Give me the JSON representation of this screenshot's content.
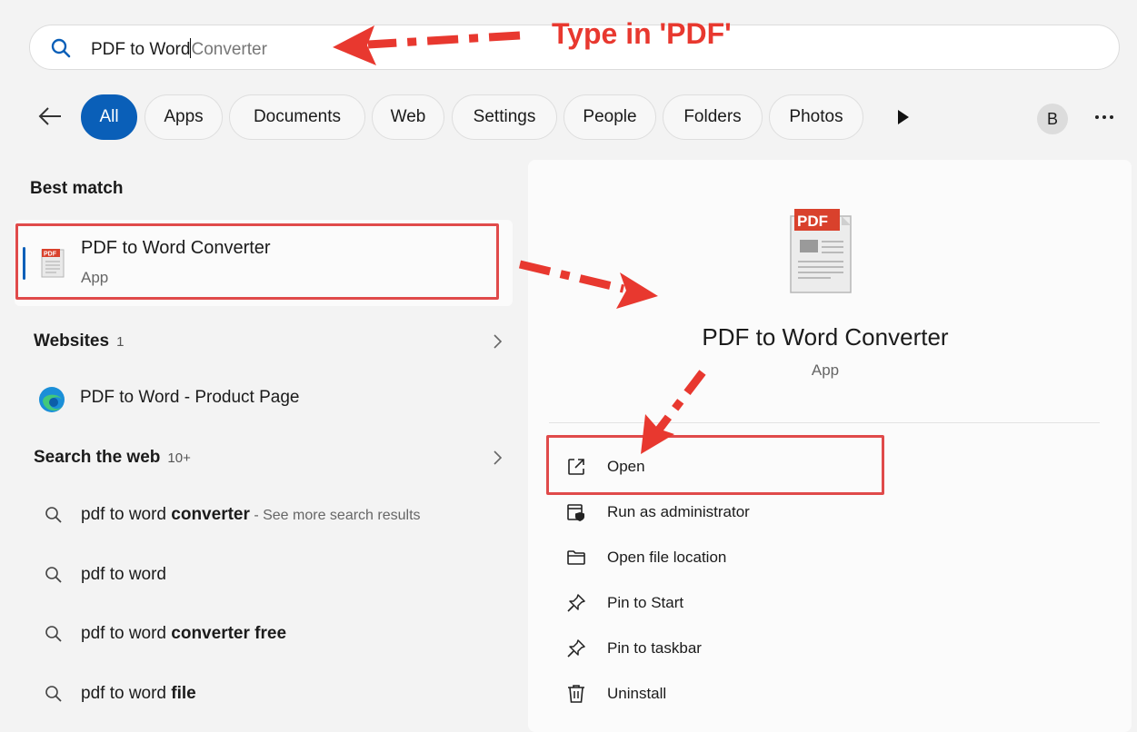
{
  "search": {
    "typed": "PDF to Word",
    "suggestion": "Converter"
  },
  "annotations": {
    "type_hint": "Type in 'PDF'",
    "accent_color": "#e8382f"
  },
  "filters": [
    "All",
    "Apps",
    "Documents",
    "Web",
    "Settings",
    "People",
    "Folders",
    "Photos"
  ],
  "active_filter": "All",
  "user": {
    "avatar_initial": "B"
  },
  "best_match": {
    "heading": "Best match",
    "title": "PDF to Word Converter",
    "subtitle": "App"
  },
  "websites": {
    "heading": "Websites",
    "count": "1",
    "items": [
      {
        "label": "PDF to Word - Product Page"
      }
    ]
  },
  "web_search": {
    "heading": "Search the web",
    "count": "10+",
    "items": [
      {
        "prefix": "pdf to word ",
        "bold": "converter",
        "suffix": " - See more search results"
      },
      {
        "prefix": "pdf to word",
        "bold": "",
        "suffix": ""
      },
      {
        "prefix": "pdf to word ",
        "bold": "converter free",
        "suffix": ""
      },
      {
        "prefix": "pdf to word ",
        "bold": "file",
        "suffix": ""
      }
    ]
  },
  "preview": {
    "icon_label": "PDF",
    "title": "PDF to Word Converter",
    "subtitle": "App",
    "actions": [
      {
        "label": "Open",
        "icon": "open-external-icon"
      },
      {
        "label": "Run as administrator",
        "icon": "admin-shield-icon"
      },
      {
        "label": "Open file location",
        "icon": "folder-icon"
      },
      {
        "label": "Pin to Start",
        "icon": "pin-icon"
      },
      {
        "label": "Pin to taskbar",
        "icon": "pin-icon"
      },
      {
        "label": "Uninstall",
        "icon": "trash-icon"
      }
    ]
  },
  "colors": {
    "accent": "#0a5fb8",
    "annotation_red": "#e8382f",
    "background": "#f3f3f3"
  }
}
